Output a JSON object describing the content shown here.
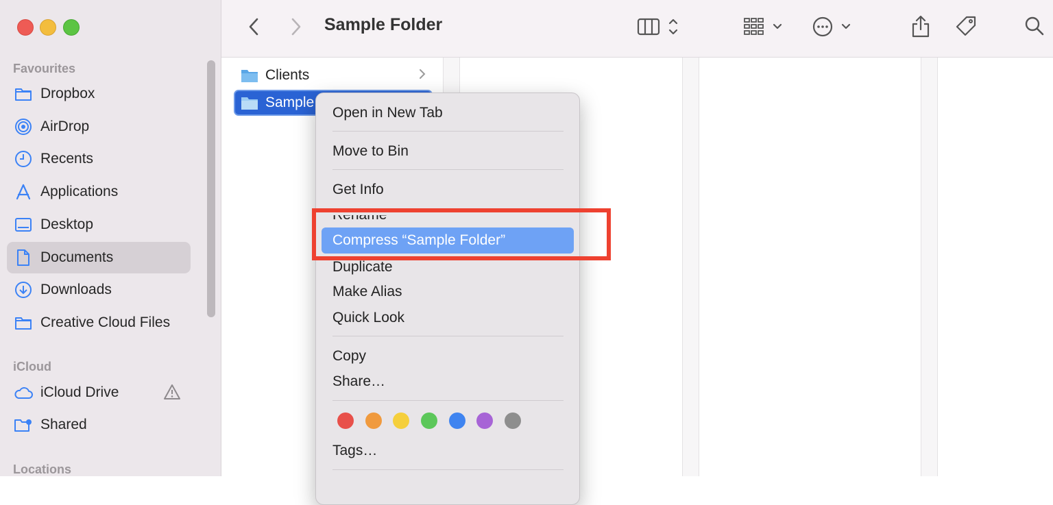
{
  "window": {
    "title": "Sample Folder"
  },
  "sidebar": {
    "favourites_title": "Favourites",
    "favourites": [
      {
        "label": "Dropbox",
        "icon": "folder-icon"
      },
      {
        "label": "AirDrop",
        "icon": "airdrop-icon"
      },
      {
        "label": "Recents",
        "icon": "clock-icon"
      },
      {
        "label": "Applications",
        "icon": "applications-icon"
      },
      {
        "label": "Desktop",
        "icon": "desktop-icon"
      },
      {
        "label": "Documents",
        "icon": "document-icon",
        "selected": true
      },
      {
        "label": "Downloads",
        "icon": "download-icon"
      },
      {
        "label": "Creative Cloud Files",
        "icon": "folder-icon"
      }
    ],
    "icloud_title": "iCloud",
    "icloud": [
      {
        "label": "iCloud Drive",
        "icon": "cloud-icon",
        "badge_icon": "warning-icon"
      },
      {
        "label": "Shared",
        "icon": "shared-folder-icon"
      }
    ],
    "locations_title": "Locations"
  },
  "columns": {
    "items": [
      {
        "label": "Clients",
        "icon": "folder-icon",
        "selected": false
      },
      {
        "label": "Sample",
        "icon": "folder-icon",
        "selected": true
      }
    ]
  },
  "context_menu": {
    "items": [
      "Open in New Tab",
      "Move to Bin",
      "Get Info",
      "Rename",
      "Compress “Sample Folder”",
      "Duplicate",
      "Make Alias",
      "Quick Look",
      "Copy",
      "Share…",
      "Tags…"
    ],
    "highlighted_index": 4,
    "tag_colors": [
      "#e8504a",
      "#f09a3e",
      "#f5cf3c",
      "#5cc75a",
      "#3f84f0",
      "#a764d6",
      "#8e8e8e"
    ]
  },
  "colors": {
    "accent": "#2a63d4",
    "highlight": "#6ea2f5",
    "annotation": "#ee4130"
  }
}
